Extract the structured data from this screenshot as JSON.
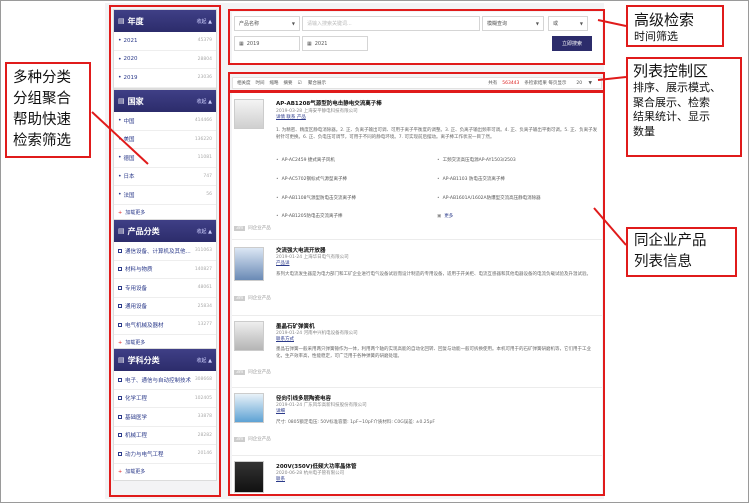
{
  "callouts": {
    "left_lines": [
      "多种分类",
      "分组聚合",
      "帮助快速",
      "检索筛选"
    ],
    "adv_title": "高级检索",
    "adv_sub": "时间筛选",
    "ctrl_title": "列表控制区",
    "ctrl_lines": [
      "排序、展示模式、",
      "聚合展示、检索",
      "结果统计、显示",
      "数量"
    ],
    "list_lines": [
      "同企业产品",
      "列表信息"
    ]
  },
  "sidebar": {
    "facets": [
      {
        "title": "年度",
        "more": "收起",
        "items": [
          {
            "label": "2021",
            "count": "45379"
          },
          {
            "label": "2020",
            "count": "28804"
          },
          {
            "label": "2019",
            "count": "23036"
          }
        ],
        "footer": null
      },
      {
        "title": "国家",
        "more": "收起",
        "items": [
          {
            "label": "中国",
            "count": "414466"
          },
          {
            "label": "美国",
            "count": "136220"
          },
          {
            "label": "德国",
            "count": "11081"
          },
          {
            "label": "日本",
            "count": "747"
          },
          {
            "label": "法国",
            "count": "56"
          }
        ],
        "footer": "加载更多"
      },
      {
        "title": "产品分类",
        "more": "收起",
        "items": [
          {
            "label": "通信设备、计算机及其他...",
            "count": "311063"
          },
          {
            "label": "材料与物质",
            "count": "140827"
          },
          {
            "label": "专用设备",
            "count": "48061"
          },
          {
            "label": "通用设备",
            "count": "25834"
          },
          {
            "label": "电气机械及器材",
            "count": "13277"
          }
        ],
        "footer": "加载更多"
      },
      {
        "title": "学科分类",
        "more": "收起",
        "items": [
          {
            "label": "电子、通信与自动控制技术",
            "count": "308668"
          },
          {
            "label": "化学工程",
            "count": "102405"
          },
          {
            "label": "基础医学",
            "count": "33878"
          },
          {
            "label": "机械工程",
            "count": "28282"
          },
          {
            "label": "动力与电气工程",
            "count": "20146"
          }
        ],
        "footer": "加载更多"
      }
    ]
  },
  "search": {
    "field_select": "产品名称",
    "keyword_placeholder": "请输入搜索关键词...",
    "match_select": "模糊查询",
    "logic_select": "或",
    "date_from": "2019",
    "date_to": "2021",
    "submit": "立即搜索"
  },
  "controls": {
    "items": [
      "相关度",
      "时间",
      "缩略",
      "摘要",
      "聚合展示"
    ],
    "result_prefix": "共有",
    "result_count": "563443",
    "result_suffix": "条检索结果 每页显示",
    "page_size": "20"
  },
  "products": [
    {
      "title": "AP-AB1208气源型防电击静电交流离子棒",
      "meta": "2019-03-28   上海安平静电科技有限公司",
      "links": "详情  联系  产品",
      "desc": "1. 为精密、精度区静电消除器。2. 正、负离子输出可调、可用于离子平衡度的调整。3. 正、负离子输出频率可调。4. 正、负离子输出平衡可调。5. 正、负离子发射针可更换。6. 正、负电压可调节，可用于不同的静电环境。7. 可实现前后摆动。离子棒工作状况一目了然。",
      "related": [
        "AP-AC2459 捷式离子风机",
        "工频交流高压电源AP-AY1503/2503",
        "AP-AC5702钢标式气源型离子棒",
        "AP-AB1103 防电击交流离子棒",
        "AP-AB1108气源型防电击交流离子棒",
        "AP-AB1601A/1602A防爆型交流高压静电消除器",
        "AP-AB1205防电击交流离子棒",
        "更多"
      ],
      "foot": "同企业产品"
    },
    {
      "title": "交流强大电流开放器",
      "meta": "2019-01-24   上海华日电气有限公司",
      "links": "产品详",
      "desc": "系列大电流发生器是为电力部门和工矿企业进行电气设备试验而设计制造的专用设备，适用于开关柜、电流互感器和其他电器设备的电流负载试验及升温试验。",
      "foot": "同企业产品"
    },
    {
      "title": "墨晶石矿弹簧机",
      "meta": "2019-01-24   河南中兴机电设备有限公司",
      "links": "联系方式",
      "desc": "墨晶石弹簧一般采用两只弹簧锤作为一体，利用两个轴的实现高能的自动化回转、回复与动能一般可拆换使用。本机可用于的石矿弹簧研磨机等，它们用于工业化，生产效率高，性能稳定，可广泛用于各种弹簧的研磨处理。",
      "foot": "同企业产品"
    },
    {
      "title": "径向引线多层陶瓷电容",
      "meta": "2019-01-24   广东风华高新科技股份有限公司",
      "links": "详细",
      "desc": "尺寸: 0805额定电压: 50V标准容量: 1pF~10pF介质材料: C0G误差: ±0.25pF",
      "foot": "同企业产品"
    },
    {
      "title": "200V(350V)低频大功率晶体管",
      "meta": "2020-06-28   杭州电子管有限公司",
      "links": "联系",
      "desc": "",
      "foot": ""
    }
  ]
}
